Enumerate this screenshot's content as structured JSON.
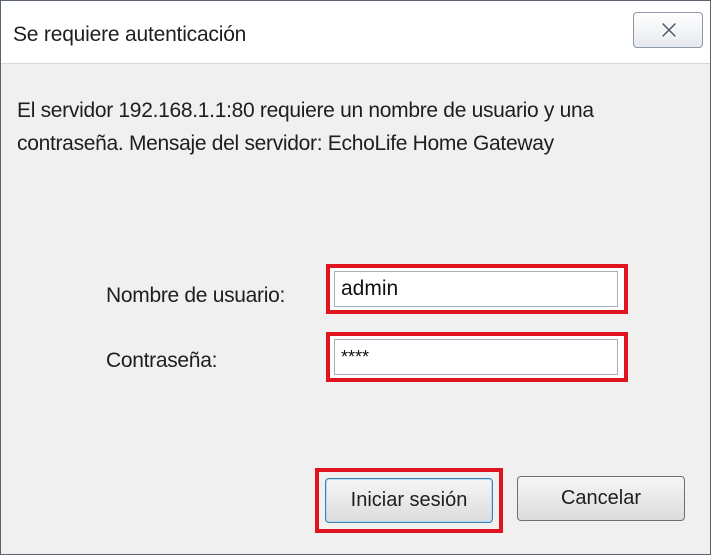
{
  "dialog": {
    "title": "Se requiere autenticación",
    "close_icon": "close-icon",
    "message": "El servidor 192.168.1.1:80 requiere un nombre de usuario y una contraseña. Mensaje del servidor: EchoLife Home Gateway"
  },
  "form": {
    "username_label": "Nombre de usuario:",
    "username_value": "admin",
    "password_label": "Contraseña:",
    "password_value": "****"
  },
  "buttons": {
    "login_label": "Iniciar sesión",
    "cancel_label": "Cancelar"
  },
  "highlight_color": "#e0141e"
}
